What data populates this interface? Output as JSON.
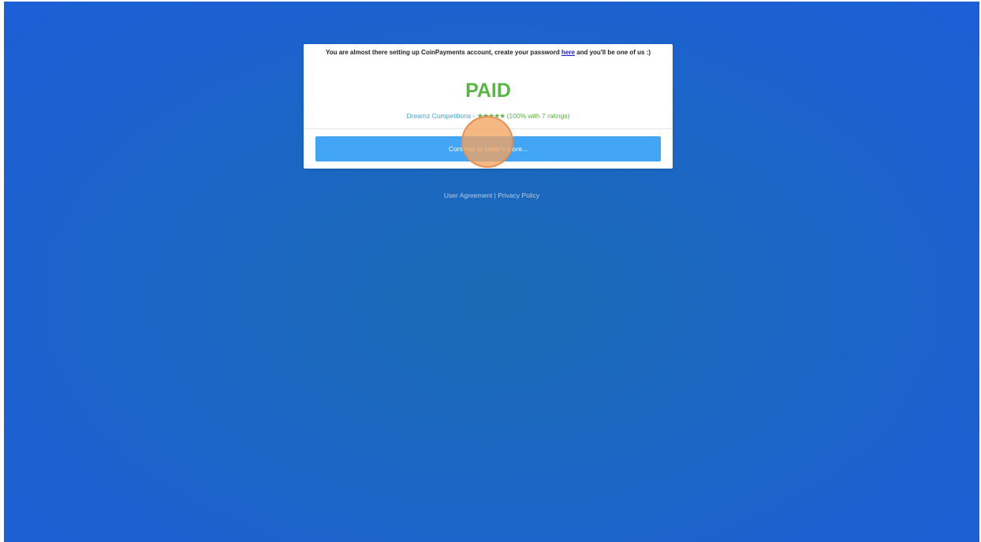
{
  "notice": {
    "before": "You are almost there setting up CoinPayments account, create your password ",
    "link": "here",
    "after": " and you'll be one of us :)"
  },
  "status": "PAID",
  "seller": {
    "name": "Dreamz Competitions",
    "separator": " - ",
    "stars": "★★★★★",
    "rating_text": " (100% with 7 ratings)",
    "star_rating": 5
  },
  "continue_button": "Continue to seller's store...",
  "footer": {
    "user_agreement": "User Agreement",
    "separator": " | ",
    "privacy_policy": "Privacy Policy"
  },
  "colors": {
    "background": "#1b66c4",
    "paid": "#5bb546",
    "button": "#42a5f5",
    "link": "#4a9fd6"
  }
}
